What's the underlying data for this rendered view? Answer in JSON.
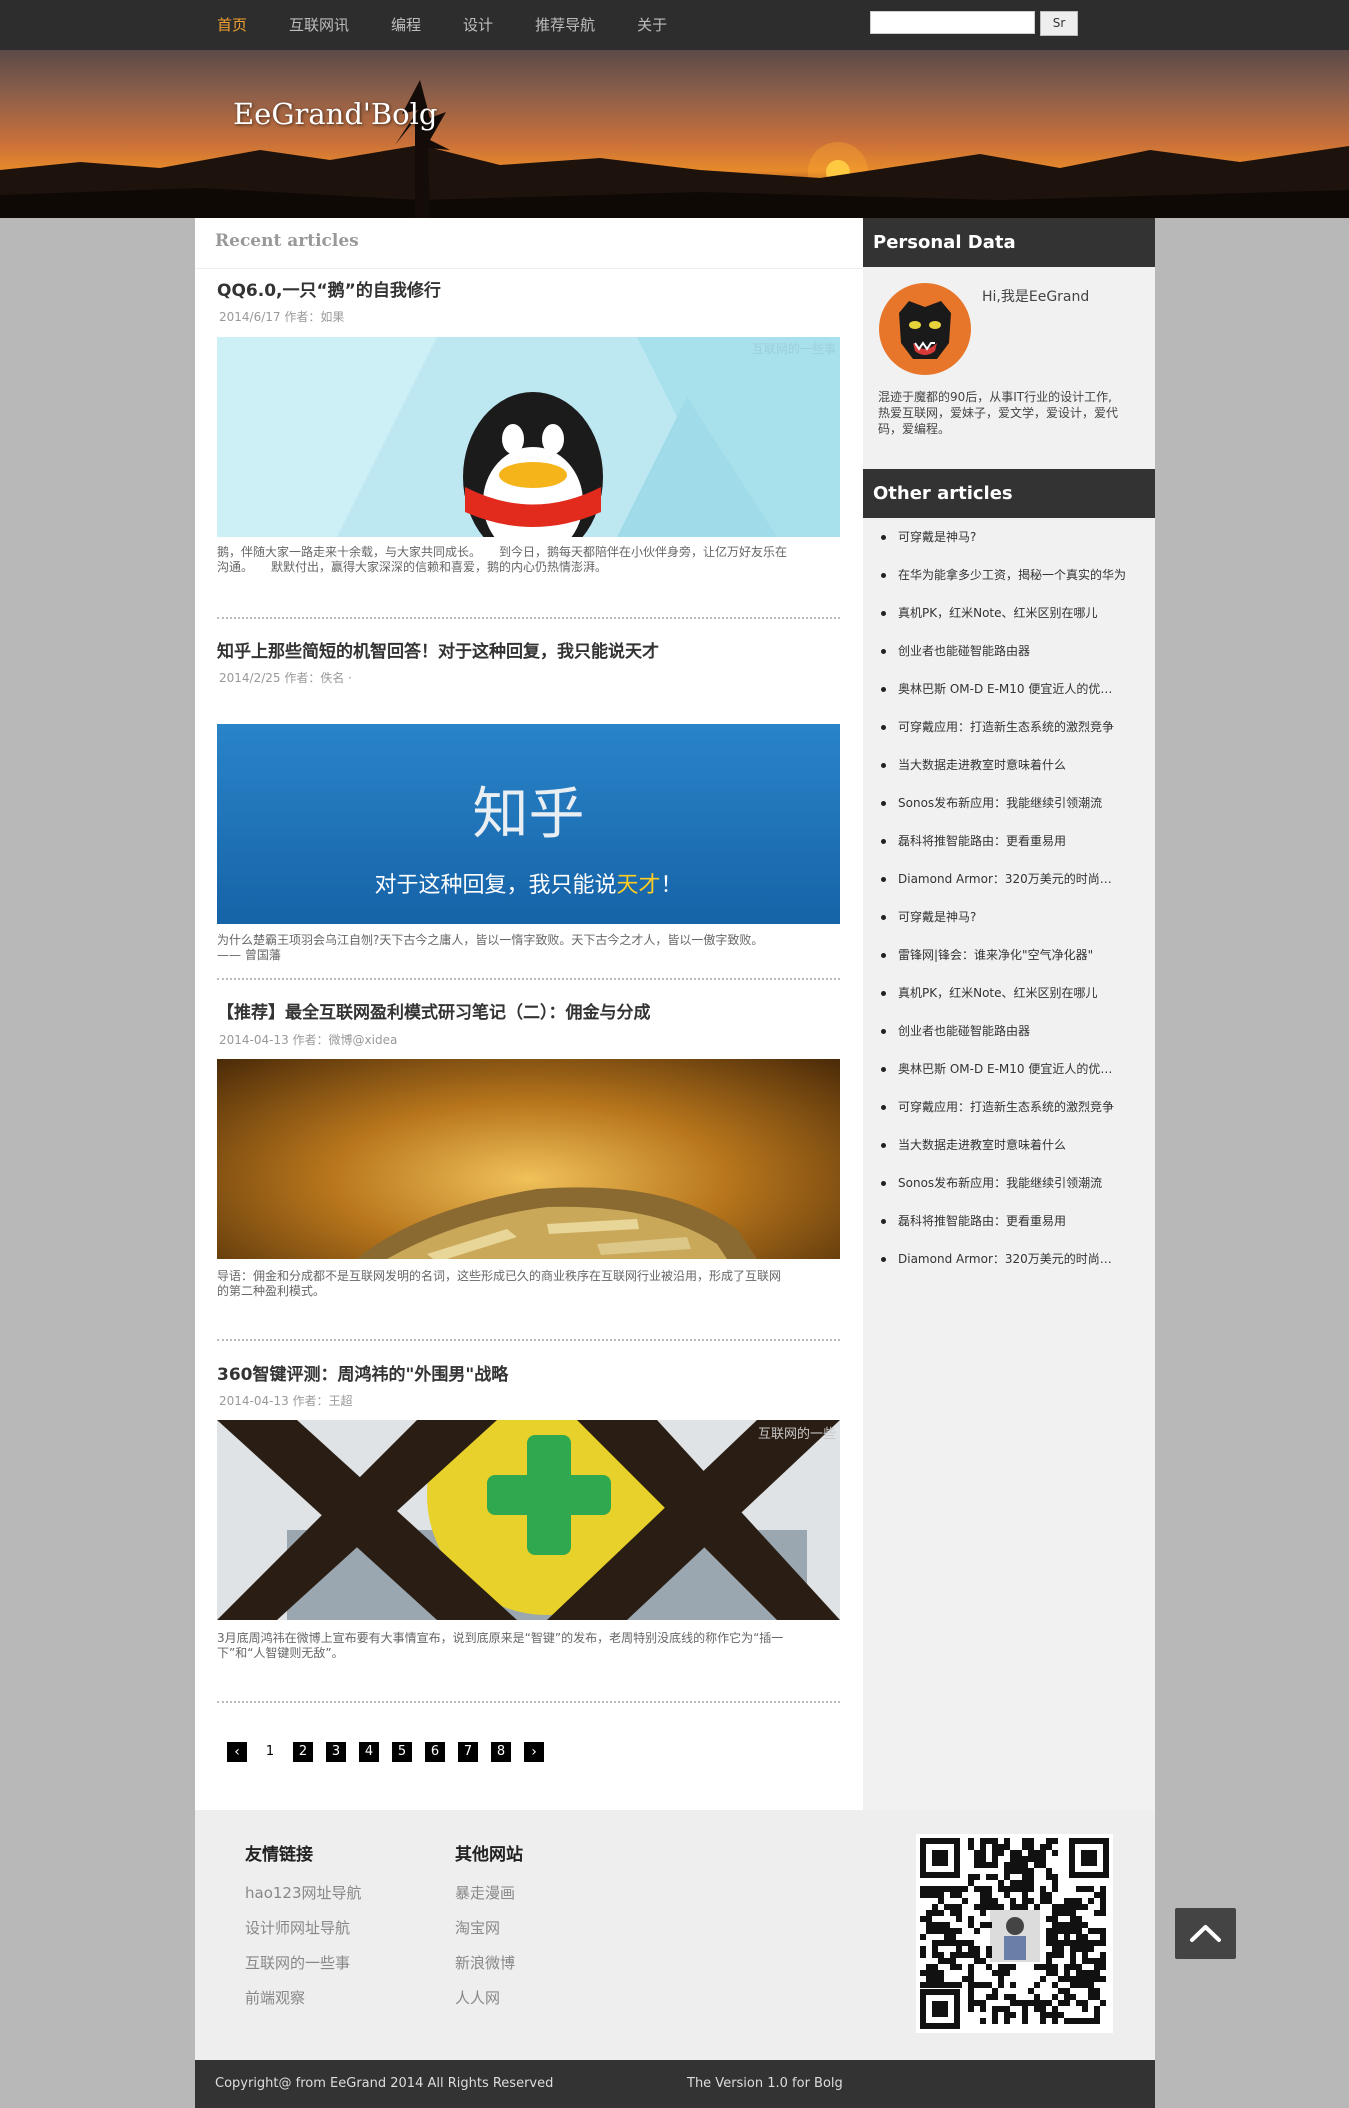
{
  "nav": {
    "items": [
      "首页",
      "互联网讯",
      "编程",
      "设计",
      "推荐导航",
      "关于"
    ],
    "search_button": "Sr",
    "search_value": ""
  },
  "header": {
    "site_title": "EeGrand'Bolg"
  },
  "main": {
    "section_title": "Recent articles",
    "articles": [
      {
        "title": "QQ6.0,一只“鹅”的自我修行",
        "meta": "2014/6/17  作者：如果",
        "image_caption": "互联网的一些事",
        "desc": "鹅，伴随大家一路走来十余载，与大家共同成长。　　到今日，鹅每天都陪伴在小伙伴身旁，让亿万好友乐在沟通。　　默默付出，赢得大家深深的信赖和喜爱，鹅的内心仍热情澎湃。"
      },
      {
        "title": "知乎上那些简短的机智回答！对于这种回复，我只能说天才",
        "meta": "2014/2/25  作者：佚名 ·",
        "image_text_big": "知乎",
        "image_text_sub": "对于这种回复，我只能说",
        "image_text_hl": "天才",
        "image_text_end": "！",
        "desc": "为什么楚霸王项羽会乌江自刎?天下古今之庸人，皆以一惰字致败。天下古今之才人，皆以一傲字致败。 —— 曾国藩"
      },
      {
        "title": "【推荐】最全互联网盈利模式研习笔记（二）：佣金与分成",
        "meta": "2014-04-13  作者：微博@xidea",
        "desc": "导语：佣金和分成都不是互联网发明的名词，这些形成已久的商业秩序在互联网行业被沿用，形成了互联网的第二种盈利模式。"
      },
      {
        "title": "360智键评测：周鸿祎的\"外围男\"战略",
        "meta": "2014-04-13  作者：王超",
        "image_caption": "互联网的一些",
        "desc": "3月底周鸿祎在微博上宣布要有大事情宣布，说到底原来是“智键”的发布，老周特别没底线的称作它为“插一下”和“人智键则无敌”。"
      }
    ],
    "pager": {
      "prev": "‹",
      "pages": [
        "1",
        "2",
        "3",
        "4",
        "5",
        "6",
        "7",
        "8"
      ],
      "current": "1",
      "next": "›"
    }
  },
  "sidebar": {
    "personal_title": "Personal Data",
    "greeting": "Hi,我是EeGrand",
    "bio": "混迹于魔都的90后，从事IT行业的设计工作,热爱互联网，爱妹子，爱文学，爱设计，爱代码，爱编程。",
    "other_title": "Other articles",
    "other_articles": [
      "可穿戴是神马?",
      "在华为能拿多少工资，揭秘一个真实的华为",
      "真机PK，红米Note、红米区别在哪儿",
      "创业者也能碰智能路由器",
      "奥林巴斯 OM-D E-M10 便宜近人的优…",
      "可穿戴应用：打造新生态系统的激烈竞争",
      "当大数据走进教室时意味着什么",
      "Sonos发布新应用：我能继续引领潮流",
      "磊科将推智能路由：更看重易用",
      "Diamond Armor：320万美元的时尚…",
      "可穿戴是神马?",
      "雷锋网|锋会：谁来净化\"空气净化器\"",
      "真机PK，红米Note、红米区别在哪儿",
      "创业者也能碰智能路由器",
      "奥林巴斯 OM-D E-M10 便宜近人的优…",
      "可穿戴应用：打造新生态系统的激烈竞争",
      "当大数据走进教室时意味着什么",
      "Sonos发布新应用：我能继续引领潮流",
      "磊科将推智能路由：更看重易用",
      "Diamond Armor：320万美元的时尚…"
    ]
  },
  "footer": {
    "links_title": "友情链接",
    "links": [
      "hao123网址导航",
      "设计师网址导航",
      "互联网的一些事",
      "前端观察"
    ],
    "sites_title": "其他网站",
    "sites": [
      "暴走漫画",
      "淘宝网",
      "新浪微博",
      "人人网"
    ],
    "copyright": "Copyright@ from EeGrand 2014 All Rights Reserved",
    "version": "The Version 1.0 for Bolg"
  }
}
